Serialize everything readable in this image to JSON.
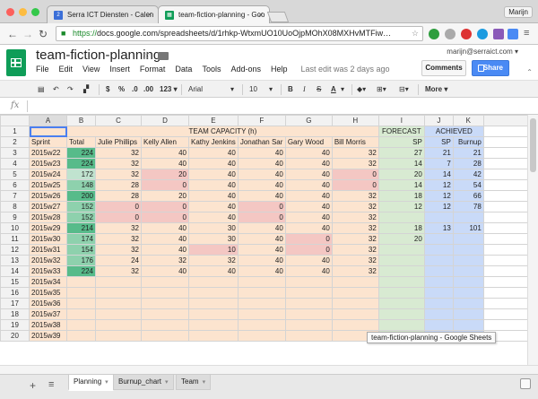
{
  "browser": {
    "tabs": [
      {
        "label": "Serra ICT Diensten - Calen",
        "icon_text": "2",
        "icon_color": "#3b6fd8",
        "close": "✕"
      },
      {
        "label": "team-fiction-planning - Goo",
        "icon_text": "▦",
        "icon_color": "#0f9d58",
        "close": "✕"
      }
    ],
    "profile": "Marijn",
    "url_scheme": "https://",
    "url_rest": "docs.google.com/spreadsheets/d/1rhkp-WtxmUO10UoOjpMOhX08MXHvMTFiw…",
    "traffic_lights": [
      "#fc605c",
      "#fdbc40",
      "#34c84a"
    ]
  },
  "doc": {
    "title": "team-fiction-planning",
    "menus": [
      "File",
      "Edit",
      "View",
      "Insert",
      "Format",
      "Data",
      "Tools",
      "Add-ons",
      "Help"
    ],
    "last_edit": "Last edit was 2 days ago",
    "user_email": "marijn@serraict.com ▾",
    "comments_label": "Comments",
    "share_label": "Share",
    "collapse": "⌃"
  },
  "toolbar": {
    "currency": "$",
    "percent": "%",
    "dec_less": ".0",
    "dec_more": ".00",
    "more_formats": "123 ▾",
    "font": "Arial",
    "font_size": "10",
    "bold": "B",
    "italic": "I",
    "strike": "S",
    "textcolor": "A",
    "more": "More ▾"
  },
  "formula": {
    "fx": "fx"
  },
  "grid": {
    "columns": [
      "A",
      "B",
      "C",
      "D",
      "E",
      "F",
      "G",
      "H",
      "I",
      "J",
      "K"
    ],
    "title_row": {
      "team_capacity": "TEAM CAPACITY (h)",
      "forecast": "FORECAST",
      "achieved": "ACHIEVED"
    },
    "header_row": [
      "Sprint",
      "Total",
      "Julie Phillips",
      "Kelly Allen",
      "Kathy Jenkins",
      "Jonathan Sar",
      "Gary Wood",
      "Bill Morris",
      "SP",
      "SP",
      "Burnup"
    ],
    "rows": [
      [
        "2015w22",
        "224",
        "32",
        "40",
        "40",
        "40",
        "40",
        "32",
        "27",
        "21",
        "21"
      ],
      [
        "2015w23",
        "224",
        "32",
        "40",
        "40",
        "40",
        "40",
        "32",
        "14",
        "7",
        "28"
      ],
      [
        "2015w24",
        "172",
        "32",
        "20",
        "40",
        "40",
        "40",
        "0",
        "20",
        "14",
        "42"
      ],
      [
        "2015w25",
        "148",
        "28",
        "0",
        "40",
        "40",
        "40",
        "0",
        "14",
        "12",
        "54"
      ],
      [
        "2015w26",
        "200",
        "28",
        "20",
        "40",
        "40",
        "40",
        "32",
        "18",
        "12",
        "66"
      ],
      [
        "2015w27",
        "152",
        "0",
        "0",
        "40",
        "0",
        "40",
        "32",
        "12",
        "12",
        "78"
      ],
      [
        "2015w28",
        "152",
        "0",
        "0",
        "40",
        "0",
        "40",
        "32",
        "",
        "",
        ""
      ],
      [
        "2015w29",
        "214",
        "32",
        "40",
        "30",
        "40",
        "40",
        "32",
        "18",
        "13",
        "101"
      ],
      [
        "2015w30",
        "174",
        "32",
        "40",
        "30",
        "40",
        "0",
        "32",
        "20",
        "",
        ""
      ],
      [
        "2015w31",
        "154",
        "32",
        "40",
        "10",
        "40",
        "0",
        "32",
        "",
        "",
        ""
      ],
      [
        "2015w32",
        "176",
        "24",
        "32",
        "32",
        "40",
        "40",
        "32",
        "",
        "",
        ""
      ],
      [
        "2015w33",
        "224",
        "32",
        "40",
        "40",
        "40",
        "40",
        "32",
        "",
        "",
        ""
      ],
      [
        "2015w34",
        "",
        "",
        "",
        "",
        "",
        "",
        "",
        "",
        "",
        ""
      ],
      [
        "2015w35",
        "",
        "",
        "",
        "",
        "",
        "",
        "",
        "",
        "",
        ""
      ],
      [
        "2015w36",
        "",
        "",
        "",
        "",
        "",
        "",
        "",
        "",
        "",
        ""
      ],
      [
        "2015w37",
        "",
        "",
        "",
        "",
        "",
        "",
        "",
        "",
        "",
        ""
      ],
      [
        "2015w38",
        "",
        "",
        "",
        "",
        "",
        "",
        "",
        "",
        "",
        ""
      ],
      [
        "2015w39",
        "",
        "",
        "",
        "",
        "",
        "",
        "",
        "",
        "",
        ""
      ]
    ],
    "total_colors": [
      "grA",
      "grA",
      "grC",
      "grB",
      "grA",
      "grB",
      "grB",
      "grA",
      "grB",
      "grB",
      "grB",
      "grA"
    ],
    "pink_cells": [
      "2-3",
      "2-7",
      "3-3",
      "3-7",
      "5-2",
      "5-3",
      "5-5",
      "6-2",
      "6-3",
      "6-5",
      "8-6",
      "9-4",
      "9-6"
    ]
  },
  "tooltip": "team-fiction-planning - Google Sheets",
  "sheets": {
    "add": "+",
    "list": "≡",
    "tabs": [
      {
        "label": "Planning",
        "dd": "▾"
      },
      {
        "label": "Burnup_chart",
        "dd": "▾"
      },
      {
        "label": "Team",
        "dd": "▾"
      }
    ]
  }
}
